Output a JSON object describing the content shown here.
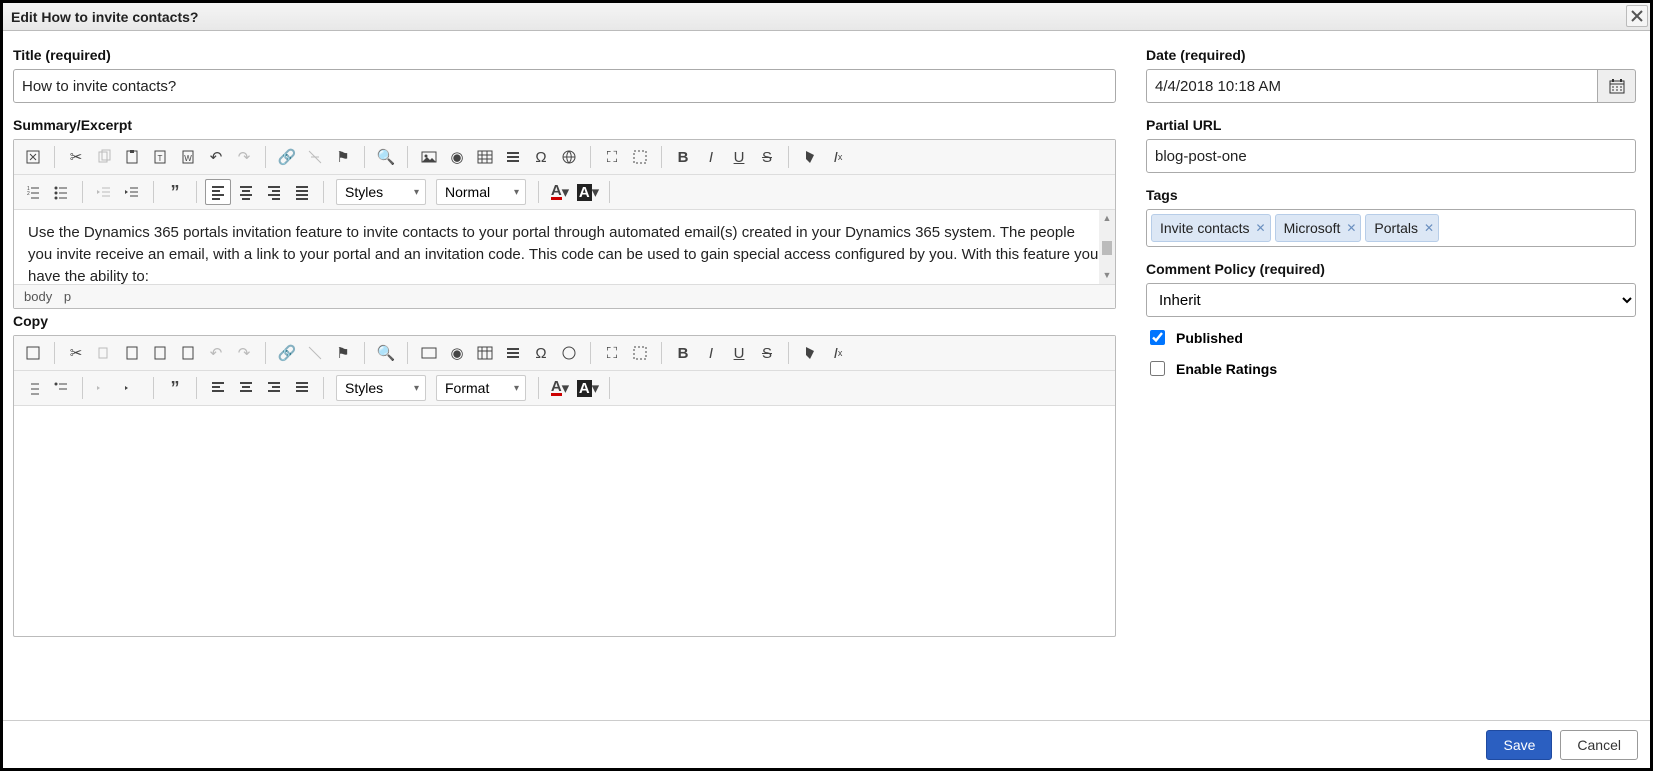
{
  "window": {
    "title": "Edit How to invite contacts?"
  },
  "left": {
    "title_label": "Title (required)",
    "title_value": "How to invite contacts?",
    "summary_label": "Summary/Excerpt",
    "summary_text": "Use the Dynamics 365 portals invitation feature to invite contacts to your portal through automated email(s) created in your Dynamics 365 system. The people you invite receive an email, with a link to your portal and an invitation code. This code can be used to gain special access configured by you. With this feature you have the ability to:",
    "path_body": "body",
    "path_p": "p",
    "copy_label": "Copy",
    "styles_label": "Styles",
    "format_normal": "Normal",
    "format_label": "Format"
  },
  "right": {
    "date_label": "Date (required)",
    "date_value": "4/4/2018 10:18 AM",
    "partial_url_label": "Partial URL",
    "partial_url_value": "blog-post-one",
    "tags_label": "Tags",
    "tags": [
      "Invite contacts",
      "Microsoft",
      "Portals"
    ],
    "comment_policy_label": "Comment Policy (required)",
    "comment_policy_value": "Inherit",
    "published_label": "Published",
    "published_checked": true,
    "ratings_label": "Enable Ratings",
    "ratings_checked": false
  },
  "footer": {
    "save": "Save",
    "cancel": "Cancel"
  }
}
